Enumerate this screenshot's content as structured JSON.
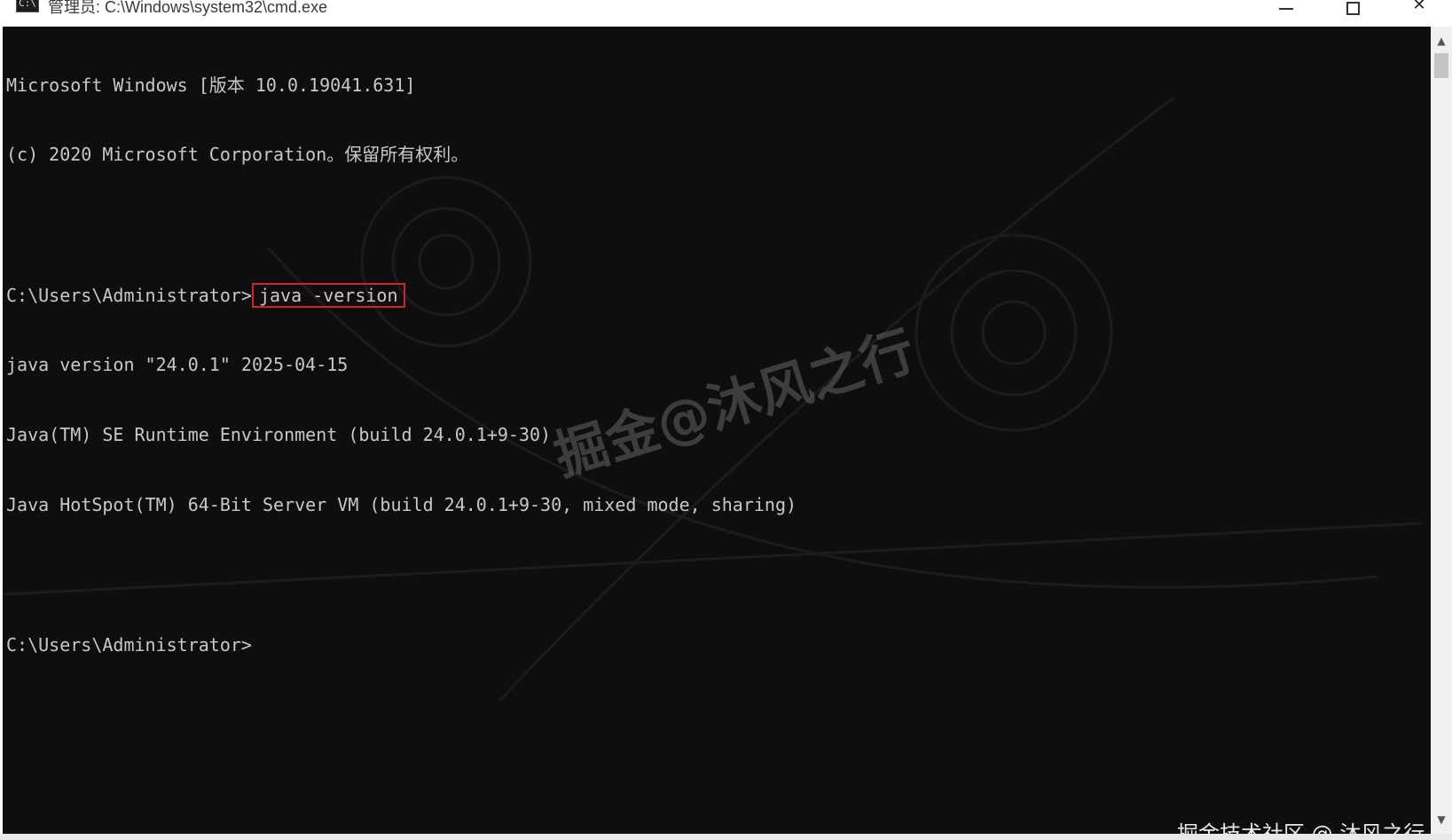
{
  "window": {
    "title": "管理员: C:\\Windows\\system32\\cmd.exe",
    "icon": "cmd-icon",
    "icon_glyph": "C:\\",
    "minimize_icon": "minimize-icon",
    "maximize_icon": "maximize-icon",
    "close_icon": "close-icon",
    "close_glyph": "✕"
  },
  "console": {
    "background_color": "#0e0e0e",
    "text_color": "#c8c8c8",
    "line1": "Microsoft Windows [版本 10.0.19041.631]",
    "line2": "(c) 2020 Microsoft Corporation。保留所有权利。",
    "line3": "",
    "prompt1": "C:\\Users\\Administrator>",
    "command": "java -version",
    "line5": "java version \"24.0.1\" 2025-04-15",
    "line6": "Java(TM) SE Runtime Environment (build 24.0.1+9-30)",
    "line7": "Java HotSpot(TM) 64-Bit Server VM (build 24.0.1+9-30, mixed mode, sharing)",
    "line8": "",
    "prompt2": "C:\\Users\\Administrator>"
  },
  "highlight": {
    "color": "#d0222a"
  },
  "scrollbar": {
    "up_glyph": "▲",
    "down_glyph": "▼"
  },
  "watermarks": {
    "center": "掘金@沐风之行",
    "corner": "掘金技术社区 @ 沐风之行"
  }
}
